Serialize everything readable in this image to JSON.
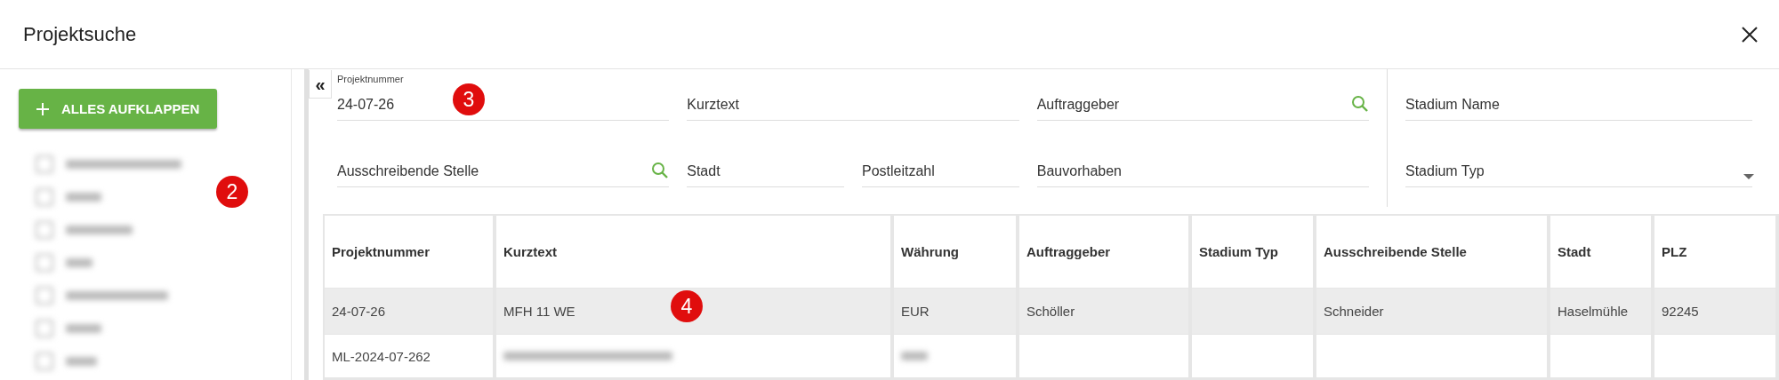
{
  "window": {
    "title": "Projektsuche"
  },
  "sidebar": {
    "expand_button": "ALLES AUFKLAPPEN",
    "items": [
      {
        "checked": false
      },
      {
        "checked": false
      },
      {
        "checked": false
      },
      {
        "checked": false
      },
      {
        "checked": false
      },
      {
        "checked": false
      },
      {
        "checked": false
      }
    ]
  },
  "collapse_button": "«",
  "filters": [
    [
      {
        "label": "Projektnummer",
        "value": "24-07-26",
        "kind": "text"
      },
      {
        "label": "Kurztext",
        "kind": "text"
      },
      {
        "label": "Auftraggeber",
        "kind": "search"
      }
    ],
    [
      {
        "label": "Ausschreibende Stelle",
        "kind": "search"
      },
      {
        "label": "Stadt",
        "kind": "text"
      },
      {
        "label": "Postleitzahl",
        "kind": "text"
      },
      {
        "label": "Bauvorhaben",
        "kind": "text"
      }
    ]
  ],
  "stadium_filters": [
    {
      "label": "Stadium Name",
      "kind": "text"
    },
    {
      "label": "Stadium Typ",
      "kind": "select"
    }
  ],
  "table": {
    "columns": [
      "Projektnummer",
      "Kurztext",
      "Währung",
      "Auftraggeber",
      "Stadium Typ",
      "Ausschreibende Stelle",
      "Stadt",
      "PLZ"
    ],
    "rows": [
      {
        "selected": true,
        "cells": [
          "24-07-26",
          "MFH 11 WE",
          "EUR",
          "Schöller",
          "",
          "Schneider",
          "Haselmühle",
          "92245"
        ]
      },
      {
        "selected": false,
        "cells": [
          "ML-2024-07-262",
          "",
          "",
          "",
          "",
          "",
          "",
          ""
        ],
        "blurred": [
          false,
          true,
          true,
          false,
          false,
          false,
          false,
          false
        ]
      }
    ]
  },
  "markers": [
    "2",
    "3",
    "4"
  ]
}
